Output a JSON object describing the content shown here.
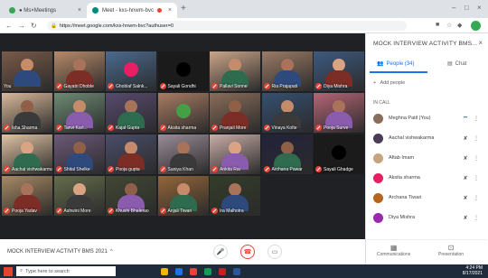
{
  "browser": {
    "tabs": [
      {
        "label": "● Ms×Meetings",
        "active": false
      },
      {
        "label": "Meet - kxs-hnwm-bvc",
        "active": true
      }
    ],
    "url": "https://meet.google.com/kxs-hnwm-bvc?authuser=0"
  },
  "meeting": {
    "name": "MOCK INTERVIEW ACTIVITY BMS 2021",
    "participants": [
      {
        "name": "You"
      },
      {
        "name": "Gayatri Dhoble"
      },
      {
        "name": "Ghoblaf Salnk..."
      },
      {
        "name": "Sayali Gondhi"
      },
      {
        "name": "Pallavi Sonne"
      },
      {
        "name": "Ria Prajapati"
      },
      {
        "name": "Diya Mishra"
      },
      {
        "name": "Isha Sharma"
      },
      {
        "name": "Tanvi Karl..."
      },
      {
        "name": "Kajal Gupta"
      },
      {
        "name": "Aksita sharma"
      },
      {
        "name": "Pranjali More"
      },
      {
        "name": "Vinaya Kolte"
      },
      {
        "name": "Pooja Surve"
      },
      {
        "name": "Aachal vishwakarma"
      },
      {
        "name": "Shital Shelke"
      },
      {
        "name": "Pooja gupta"
      },
      {
        "name": "Saniya Khan"
      },
      {
        "name": "Ankita Rai"
      },
      {
        "name": "Archana Pawar"
      },
      {
        "name": "Sayali Ghadge"
      },
      {
        "name": "Pooja Yadav"
      },
      {
        "name": "Ashwini More"
      },
      {
        "name": "Khushi Bhalerao"
      },
      {
        "name": "Anjali Tiwari"
      },
      {
        "name": "Ira Malhotra"
      }
    ]
  },
  "panel": {
    "title": "MOCK INTERVIEW ACTIVITY BMS...",
    "tab_people": "People (34)",
    "tab_chat": "Chat",
    "add_people": "Add people",
    "section": "IN CALL",
    "rows": [
      {
        "name": "Meghna Patil (You)"
      },
      {
        "name": "Aachal vishwakarma"
      },
      {
        "name": "Aftab Imam"
      },
      {
        "name": "Aksita sharma"
      },
      {
        "name": "Archana Tiwari"
      },
      {
        "name": "Diya Mishra"
      }
    ],
    "footer_left": "Communications",
    "footer_right": "Presentation"
  },
  "taskbar": {
    "search": "Type here to search",
    "time": "4:24 PM",
    "date": "8/17/2021"
  },
  "colors": {
    "accent": "#1a73e8",
    "muted_mic": "#ea4335",
    "stage_bg": "#202124"
  }
}
